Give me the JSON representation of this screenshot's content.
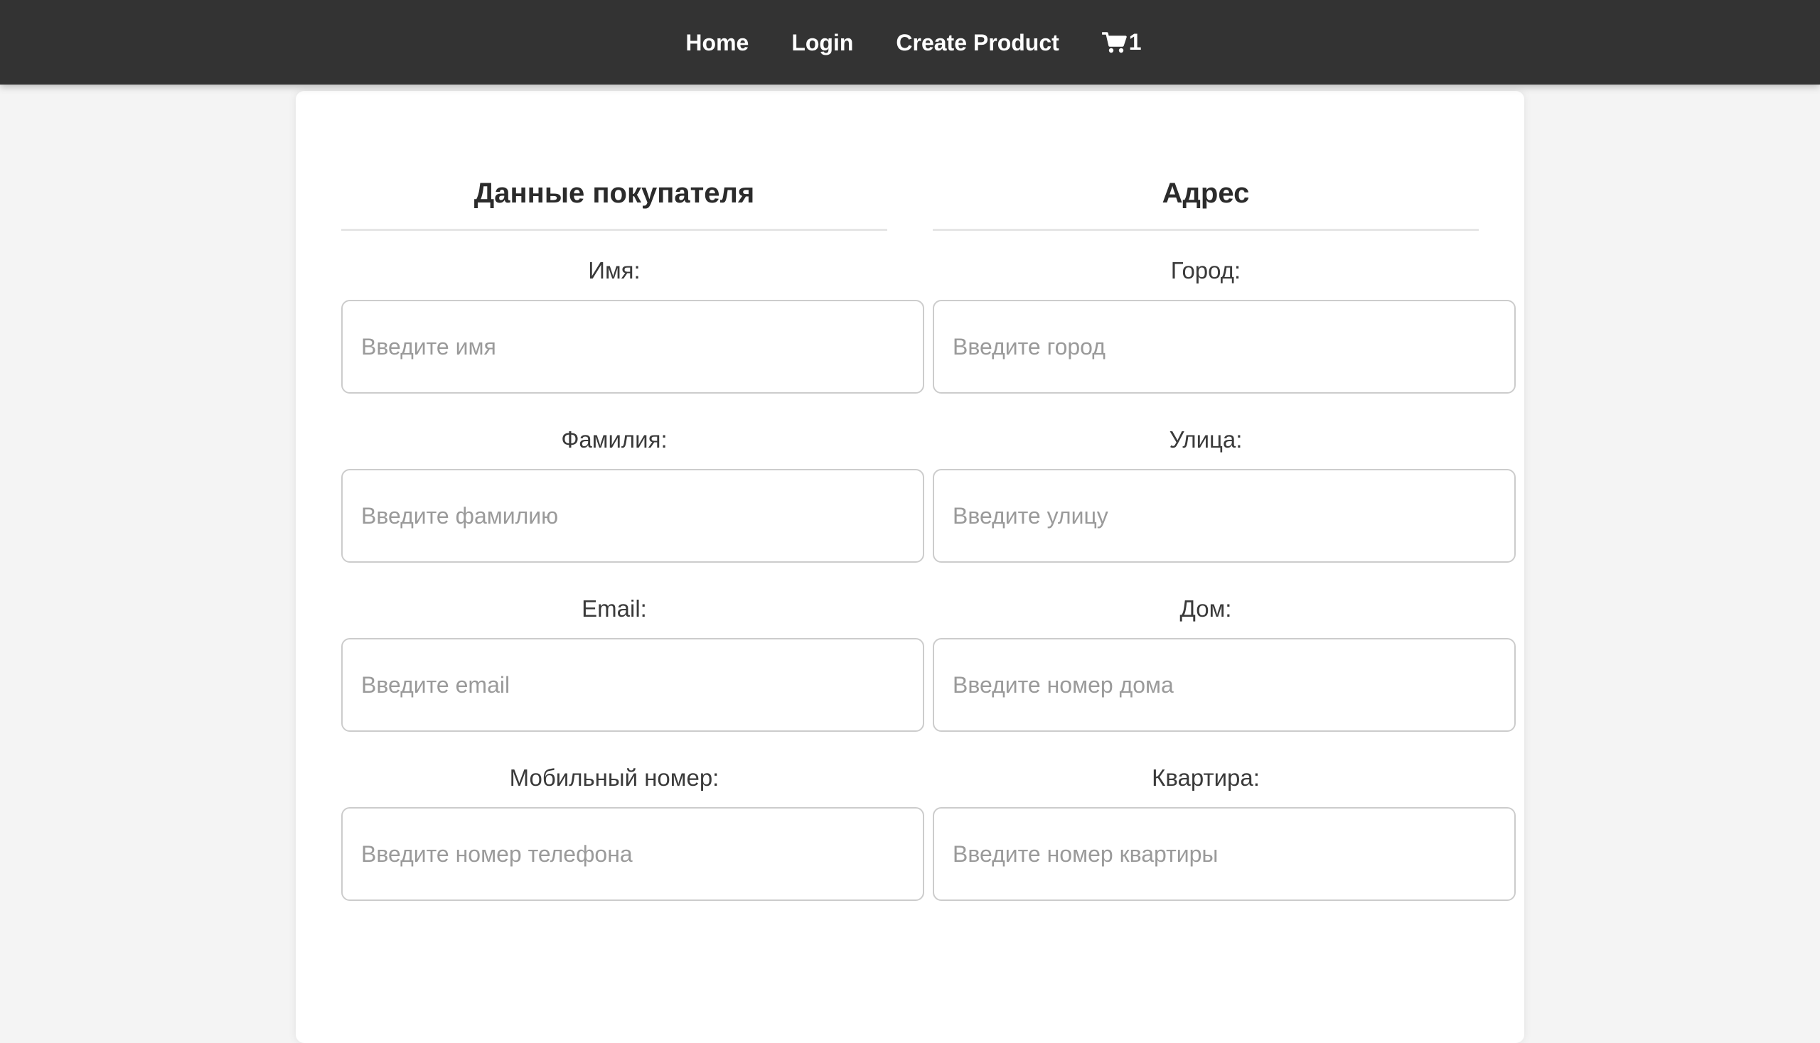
{
  "nav": {
    "home": "Home",
    "login": "Login",
    "create_product": "Create Product",
    "cart_icon": "shopping-cart-icon",
    "cart_count": "1"
  },
  "customer": {
    "title": "Данные покупателя",
    "fields": [
      {
        "label": "Имя:",
        "placeholder": "Введите имя",
        "value": ""
      },
      {
        "label": "Фамилия:",
        "placeholder": "Введите фамилию",
        "value": ""
      },
      {
        "label": "Email:",
        "placeholder": "Введите email",
        "value": ""
      },
      {
        "label": "Мобильный номер:",
        "placeholder": "Введите номер телефона",
        "value": ""
      }
    ]
  },
  "address": {
    "title": "Адрес",
    "fields": [
      {
        "label": "Город:",
        "placeholder": "Введите город",
        "value": ""
      },
      {
        "label": "Улица:",
        "placeholder": "Введите улицу",
        "value": ""
      },
      {
        "label": "Дом:",
        "placeholder": "Введите номер дома",
        "value": ""
      },
      {
        "label": "Квартира:",
        "placeholder": "Введите номер квартиры",
        "value": ""
      }
    ]
  },
  "colors": {
    "navbar_bg": "#333333",
    "page_bg": "#f4f4f4",
    "card_bg": "#ffffff",
    "input_border": "#cccccc",
    "placeholder": "#9a9a9a"
  }
}
